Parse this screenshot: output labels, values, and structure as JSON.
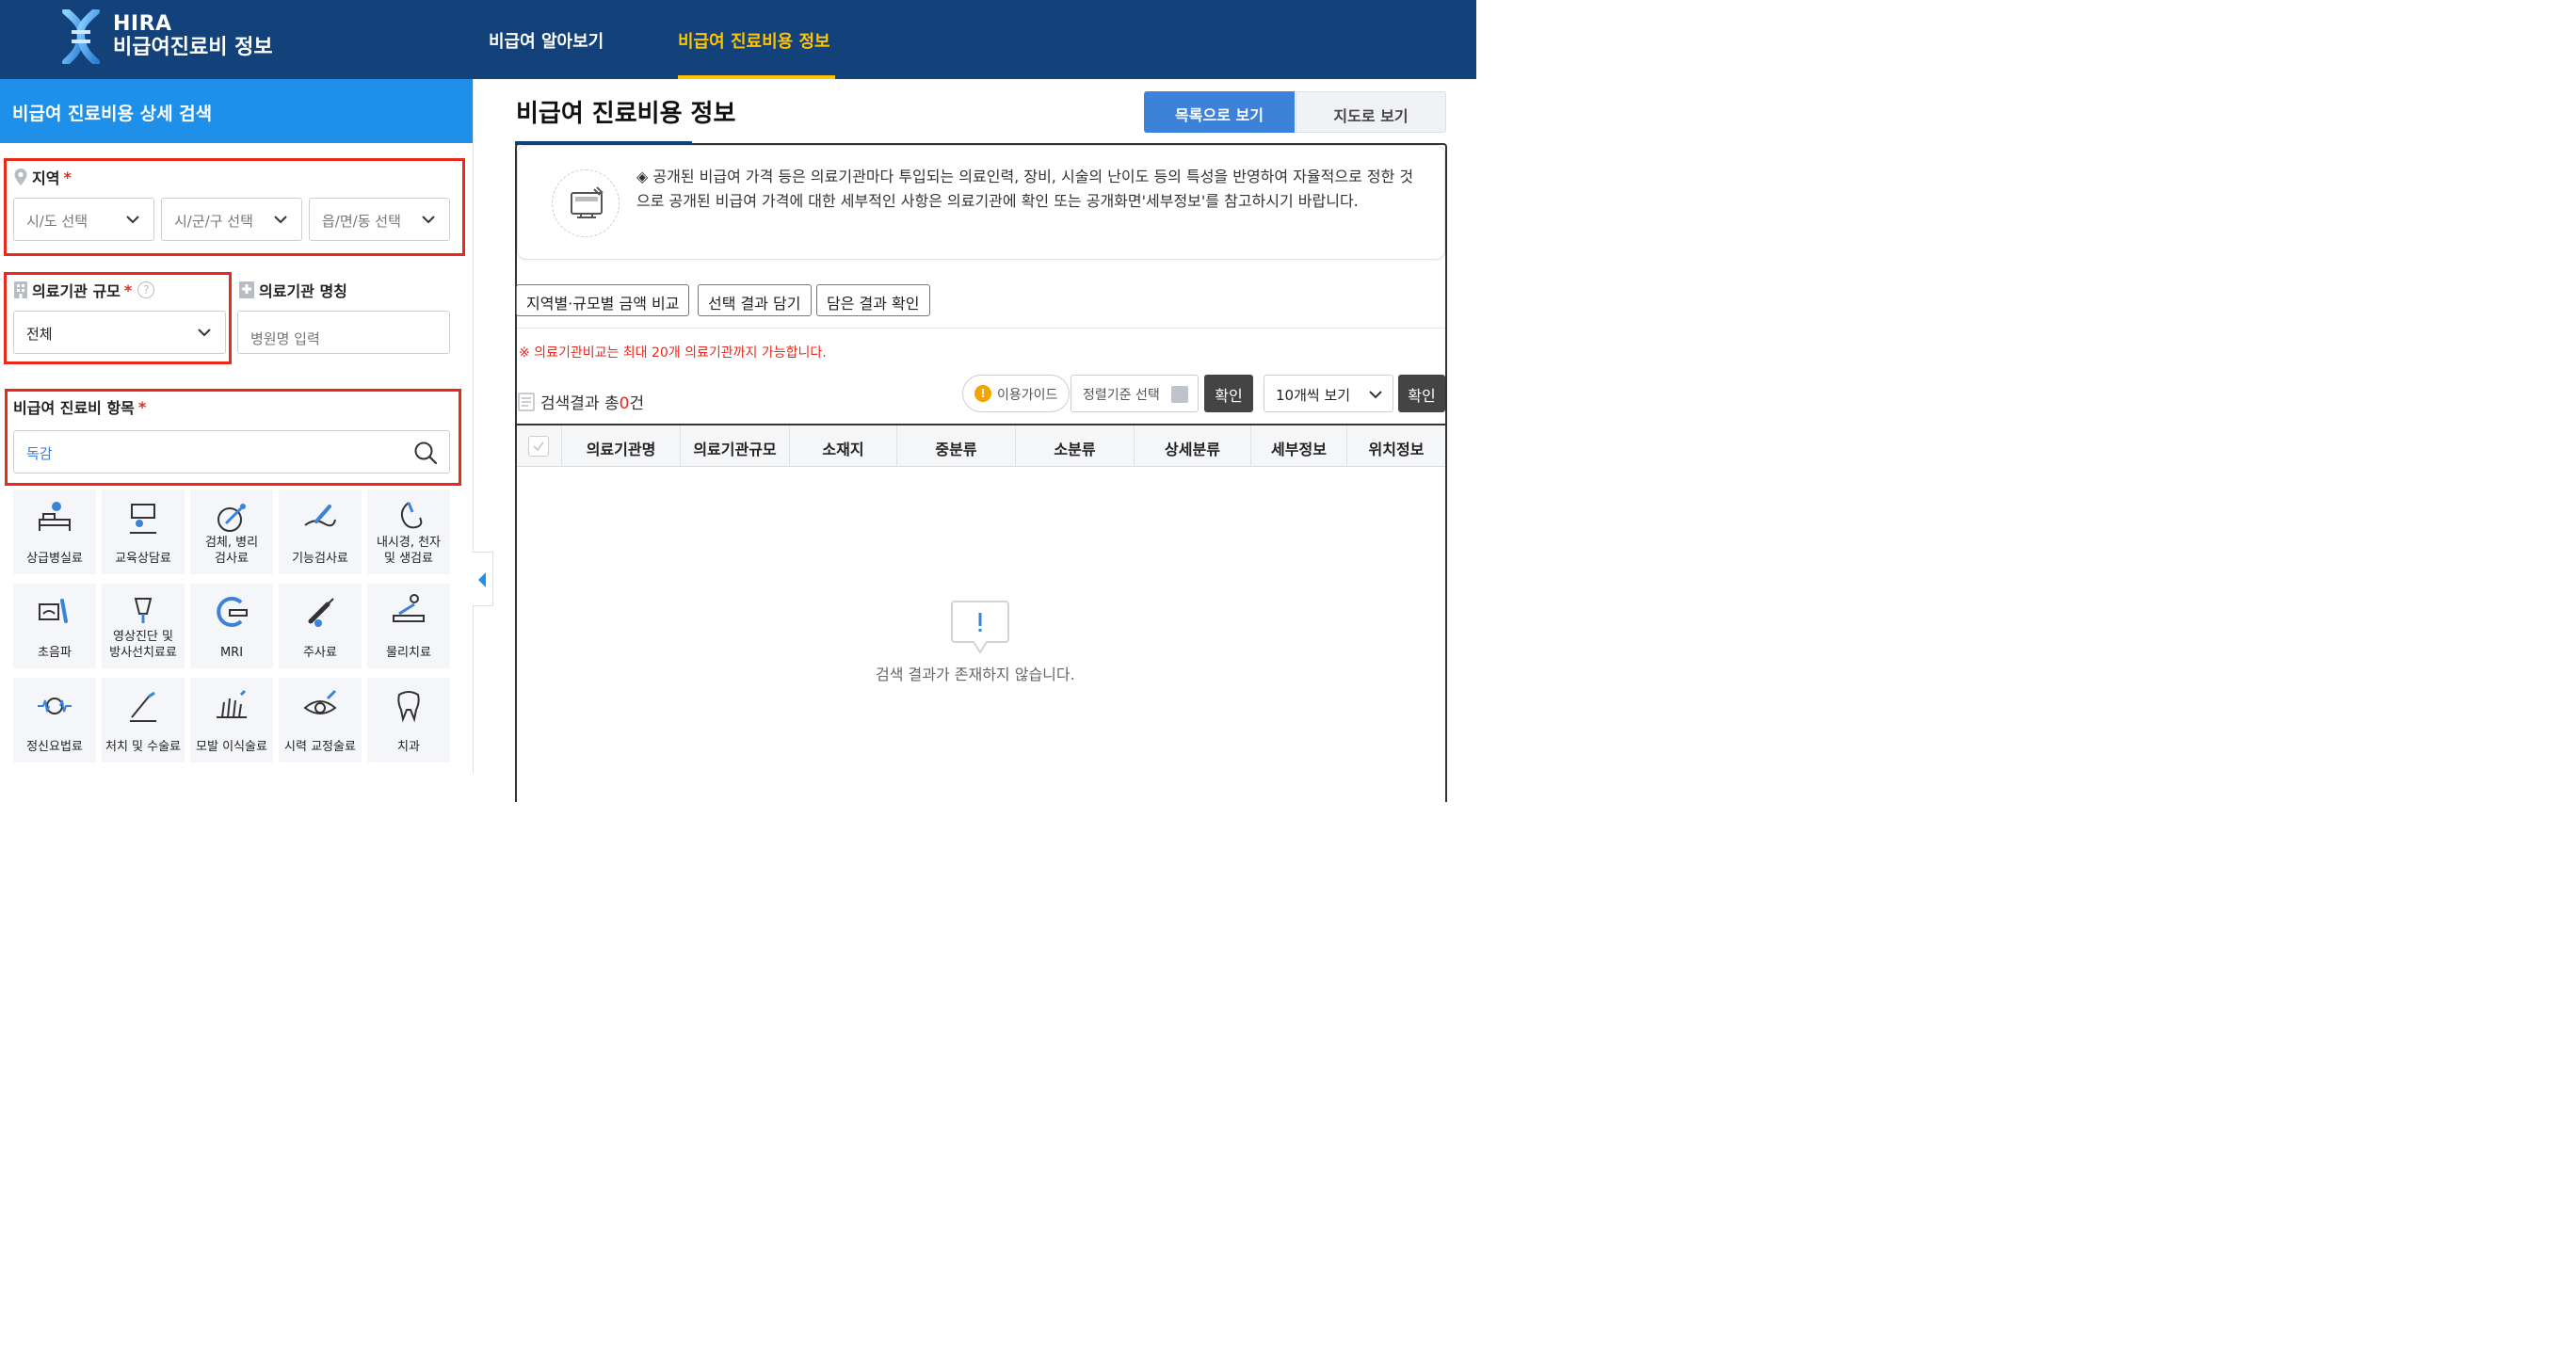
{
  "header": {
    "logo_top": "HIRA",
    "logo_bottom": "비급여진료비 정보",
    "nav": [
      {
        "label": "비급여 알아보기",
        "active": false
      },
      {
        "label": "비급여 진료비용 정보",
        "active": true
      }
    ]
  },
  "left": {
    "title": "비급여 진료비용 상세 검색",
    "region": {
      "label": "지역",
      "required": "*",
      "selects": [
        "시/도 선택",
        "시/군/구 선택",
        "읍/면/동 선택"
      ]
    },
    "scale": {
      "label": "의료기관 규모",
      "required": "*",
      "help": "?",
      "value": "전체"
    },
    "name": {
      "label": "의료기관 명칭",
      "placeholder": "병원명 입력"
    },
    "item": {
      "label": "비급여 진료비 항목",
      "required": "*",
      "value": "독감"
    },
    "tiles": [
      {
        "line1": "상급병실료",
        "line2": "",
        "icon": "bed-icon"
      },
      {
        "line1": "교육상담료",
        "line2": "",
        "icon": "counseling-icon"
      },
      {
        "line1": "검체, 병리",
        "line2": "검사료",
        "icon": "specimen-icon"
      },
      {
        "line1": "기능검사료",
        "line2": "",
        "icon": "function-test-icon"
      },
      {
        "line1": "내시경, 천자",
        "line2": "및 생검료",
        "icon": "endoscope-icon"
      },
      {
        "line1": "초음파",
        "line2": "",
        "icon": "ultrasound-icon"
      },
      {
        "line1": "영상진단 및",
        "line2": "방사선치료료",
        "icon": "xray-icon"
      },
      {
        "line1": "MRI",
        "line2": "",
        "icon": "mri-icon"
      },
      {
        "line1": "주사료",
        "line2": "",
        "icon": "syringe-icon"
      },
      {
        "line1": "물리치료",
        "line2": "",
        "icon": "physio-icon"
      },
      {
        "line1": "정신요법료",
        "line2": "",
        "icon": "brain-wave-icon"
      },
      {
        "line1": "처치 및 수술료",
        "line2": "",
        "icon": "surgery-icon"
      },
      {
        "line1": "모발 이식술료",
        "line2": "",
        "icon": "hair-icon"
      },
      {
        "line1": "시력 교정술료",
        "line2": "",
        "icon": "eye-icon"
      },
      {
        "line1": "치과",
        "line2": "",
        "icon": "tooth-icon"
      }
    ]
  },
  "main": {
    "title": "비급여 진료비용 정보",
    "view_list": "목록으로 보기",
    "view_map": "지도로 보기",
    "notice": "◈ 공개된 비급여 가격 등은 의료기관마다 투입되는 의료인력, 장비, 시술의 난이도 등의 특성을 반영하여 자율적으로 정한 것으로 공개된 비급여 가격에 대한 세부적인 사항은 의료기관에 확인 또는 공개화면'세부정보'를 참고하시기 바랍니다.",
    "tools": [
      "지역별·규모별 금액 비교",
      "선택 결과 담기",
      "담은 결과 확인"
    ],
    "warning": "※ 의료기관비교는 최대 20개 의료기관까지 가능합니다.",
    "result_prefix": "검색결과 총",
    "result_count": "0",
    "result_suffix": "건",
    "guide": "이용가이드",
    "sort": "정렬기준 선택",
    "confirm": "확인",
    "perpage": "10개씩 보기",
    "columns": [
      "의료기관명",
      "의료기관규모",
      "소재지",
      "중분류",
      "소분류",
      "상세분류",
      "세부정보",
      "위치정보"
    ],
    "empty": "검색 결과가 존재하지 않습니다."
  },
  "colors": {
    "header_bg": "#13427a",
    "accent_yellow": "#ffc400",
    "left_title_bg": "#1e90ea",
    "highlight_red": "#e8291c",
    "primary_button": "#3b82d8"
  }
}
